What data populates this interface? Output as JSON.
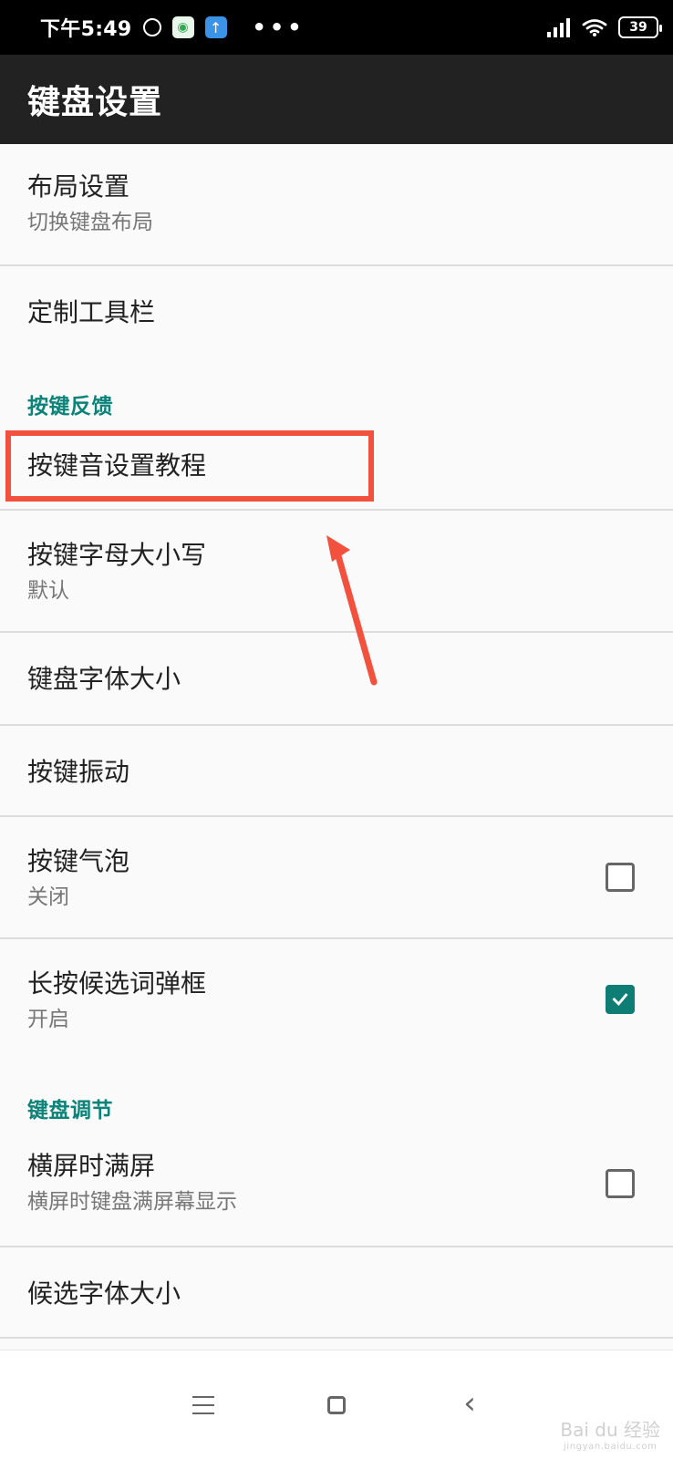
{
  "status_bar": {
    "time": "下午5:49",
    "battery": "39"
  },
  "app_bar": {
    "title": "键盘设置"
  },
  "settings": {
    "layout": {
      "title": "布局设置",
      "subtitle": "切换键盘布局"
    },
    "toolbar": {
      "title": "定制工具栏"
    },
    "section_feedback": "按键反馈",
    "key_sound_tutorial": {
      "title": "按键音设置教程"
    },
    "letter_case": {
      "title": "按键字母大小写",
      "subtitle": "默认"
    },
    "font_size": {
      "title": "键盘字体大小"
    },
    "vibration": {
      "title": "按键振动"
    },
    "bubble": {
      "title": "按键气泡",
      "subtitle": "关闭",
      "checked": false
    },
    "candidate_popup": {
      "title": "长按候选词弹框",
      "subtitle": "开启",
      "checked": true
    },
    "section_adjust": "键盘调节",
    "landscape_fullscreen": {
      "title": "横屏时满屏",
      "subtitle": "横屏时键盘满屏幕显示",
      "checked": false
    },
    "candidate_font_size": {
      "title": "候选字体大小"
    }
  },
  "watermark": {
    "brand": "Bai du 经验",
    "url": "jingyan.baidu.com"
  },
  "colors": {
    "accent": "#0e7d73",
    "highlight": "#f2513e",
    "app_bar": "#222222"
  }
}
